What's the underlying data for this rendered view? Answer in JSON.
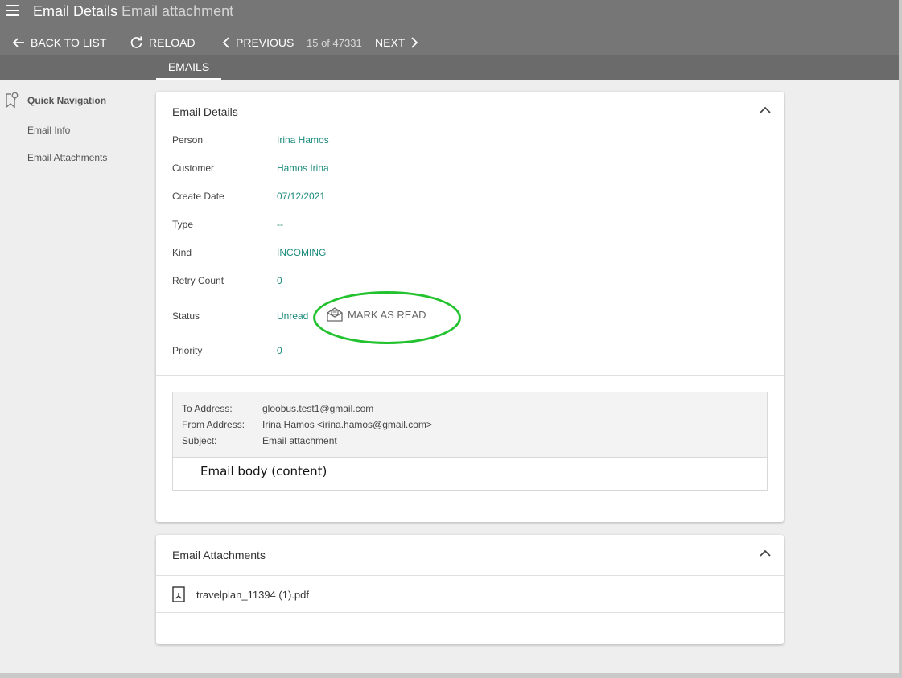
{
  "header": {
    "title_main": "Email Details",
    "title_sub": "Email attachment"
  },
  "actions": {
    "back": "BACK TO LIST",
    "reload": "RELOAD",
    "previous": "PREVIOUS",
    "counter": "15 of 47331",
    "next": "NEXT"
  },
  "tabs": [
    {
      "label": "EMAILS",
      "active": true
    }
  ],
  "sidebar": {
    "title": "Quick Navigation",
    "items": [
      {
        "label": "Email Info"
      },
      {
        "label": "Email Attachments"
      }
    ]
  },
  "details": {
    "title": "Email Details",
    "rows": [
      {
        "label": "Person",
        "value": "Irina Hamos"
      },
      {
        "label": "Customer",
        "value": "Hamos Irina"
      },
      {
        "label": "Create Date",
        "value": "07/12/2021"
      },
      {
        "label": "Type",
        "value": "--"
      },
      {
        "label": "Kind",
        "value": "INCOMING"
      },
      {
        "label": "Retry Count",
        "value": "0"
      },
      {
        "label": "Status",
        "value": "Unread"
      },
      {
        "label": "Priority",
        "value": "0"
      }
    ],
    "mark_read_label": "MARK AS READ",
    "email": {
      "to_label": "To Address:",
      "to_value": "gloobus.test1@gmail.com",
      "from_label": "From Address:",
      "from_value": "Irina Hamos <irina.hamos@gmail.com>",
      "subject_label": "Subject:",
      "subject_value": "Email attachment",
      "body": "Email body (content)"
    }
  },
  "attachments": {
    "title": "Email Attachments",
    "items": [
      {
        "name": "travelplan_11394 (1).pdf"
      }
    ]
  },
  "colors": {
    "topbar": "#767676",
    "tabbar": "#6b6b6b",
    "accent_value": "#1a8a7a",
    "annotation": "#22c22e"
  }
}
